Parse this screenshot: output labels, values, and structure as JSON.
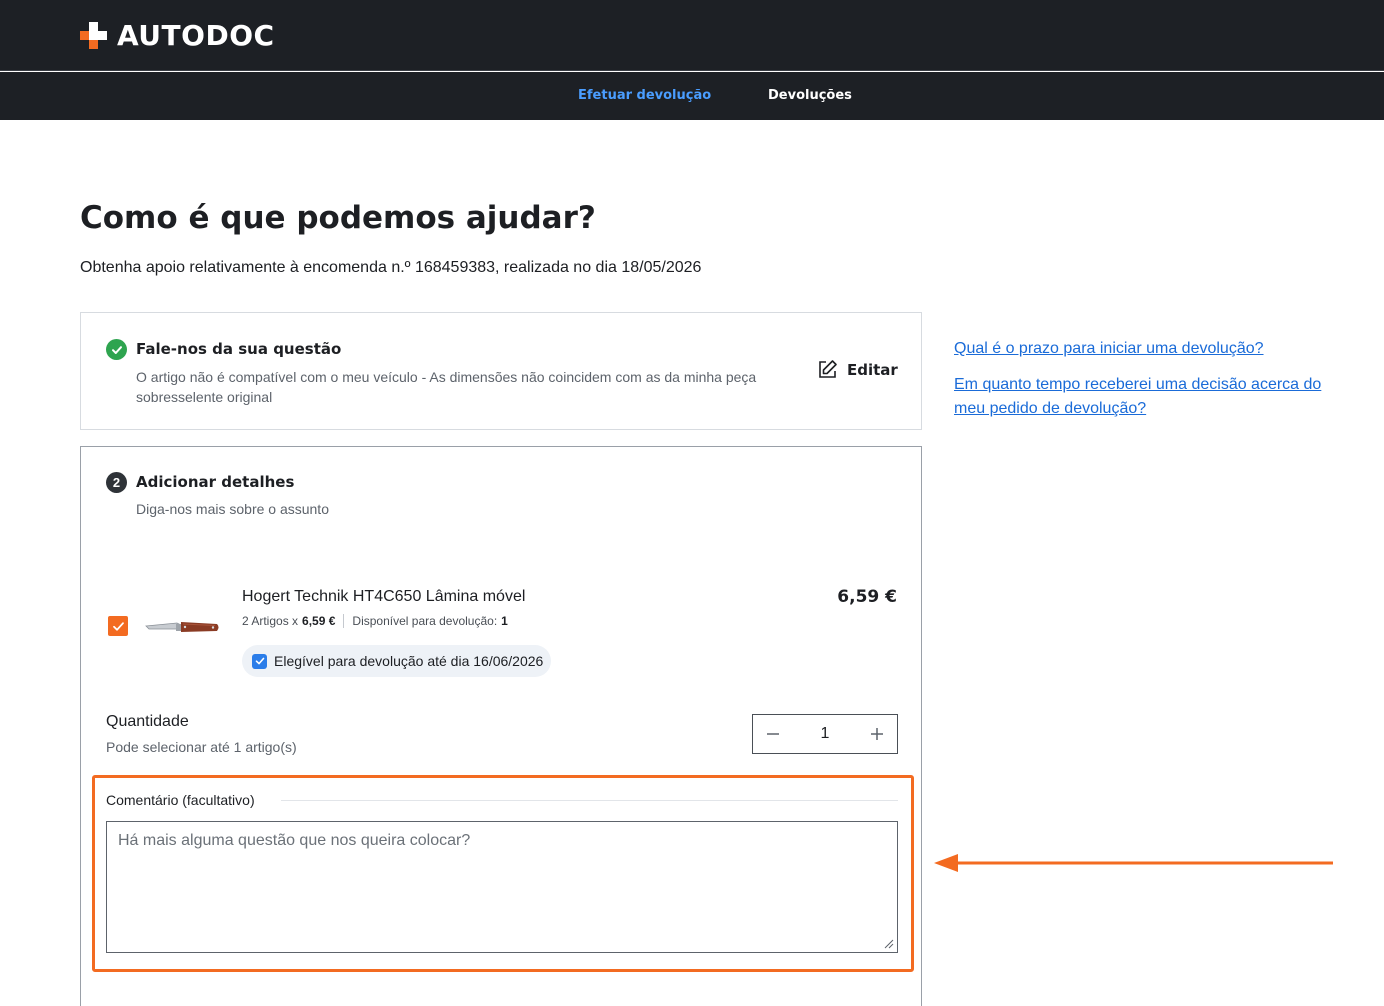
{
  "header": {
    "logo_text": "AUTODOC",
    "nav": [
      {
        "label": "Efetuar devolução",
        "active": true
      },
      {
        "label": "Devoluções",
        "active": false
      }
    ]
  },
  "page": {
    "title": "Como é que podemos ajudar?",
    "subtitle": "Obtenha apoio relativamente à encomenda n.º 168459383, realizada no dia 18/05/2026"
  },
  "step1": {
    "title": "Fale-nos da sua questão",
    "description": "O artigo não é compatível com o meu veículo - As dimensões não coincidem com as da minha peça sobresselente original",
    "edit_label": "Editar",
    "status": "completed"
  },
  "step2": {
    "number": "2",
    "title": "Adicionar detalhes",
    "description": "Diga-nos mais sobre o assunto",
    "product": {
      "name": "Hogert Technik HT4C650 Lâmina móvel",
      "quantity_text": "2 Artigos x",
      "unit_price": "6,59 €",
      "available_text": "Disponível para devolução:",
      "available_count": "1",
      "price": "6,59 €",
      "eligible_text": "Elegível para devolução até dia 16/06/2026",
      "selected": true
    },
    "quantity": {
      "title": "Quantidade",
      "hint": "Pode selecionar até 1 artigo(s)",
      "value": "1"
    },
    "comment": {
      "label": "Comentário (facultativo)",
      "placeholder": "Há mais alguma questão que nos queira colocar?",
      "value": ""
    }
  },
  "faq": [
    {
      "question": "Qual é o prazo para iniciar uma devolução?"
    },
    {
      "question": "Em quanto tempo receberei uma decisão acerca do meu pedido de devolução?"
    }
  ],
  "annotation": {
    "highlight_color": "#f36b21"
  },
  "colors": {
    "brand_orange": "#f36b21",
    "header_bg": "#1d2025",
    "nav_active": "#4a9dff",
    "link": "#1a6bd8",
    "success": "#2ea44f"
  }
}
